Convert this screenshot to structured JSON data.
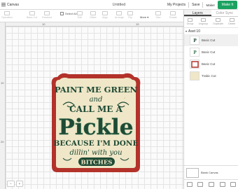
{
  "topbar": {
    "canvas_label": "Canvas",
    "title": "Untitled",
    "my_projects": "My Projects",
    "save": "Save",
    "machine_label": "Maker",
    "machine_sub": "",
    "make_button": "Make It"
  },
  "toolbar": {
    "tools": [
      "Operation",
      "Basic Cut",
      "Deselect",
      "Edit",
      "Offset",
      "Align",
      "Arrange",
      "Flip",
      "Size",
      "Rotate",
      "Position"
    ],
    "select_all": "Select All",
    "more": "More"
  },
  "rulers": {
    "top": [
      "10",
      "15"
    ],
    "left": [
      "10",
      "15",
      "20"
    ]
  },
  "design": {
    "lines": [
      "PAINT ME GREEN",
      "and",
      "CALL ME A",
      "Pickle",
      "BECAUSE I'M DONE",
      "dillin' with you",
      "BITCHES"
    ],
    "colors": {
      "frame_red": "#b3322a",
      "cream": "#efe7c8",
      "dark_green": "#1f4a35",
      "accent_green": "#3f7a57"
    }
  },
  "panel": {
    "tabs": [
      "Layers",
      "Color Sync"
    ],
    "layer_tools": [
      "Group",
      "Ungroup",
      "Duplicate",
      "Delete"
    ],
    "set_name": "Aset 10",
    "layers": [
      {
        "label": "Basic Cut",
        "thumb": "pickle-text-thumb"
      },
      {
        "label": "Basic Cut",
        "thumb": "pickle-text-thumb"
      },
      {
        "label": "Basic Cut",
        "thumb": "frame-thumb"
      },
      {
        "label": "Trabic Cut",
        "thumb": "cream-fill-thumb"
      }
    ],
    "blank_canvas": "Blank Canvas"
  },
  "zoom": {
    "minus": "−",
    "plus": "+"
  }
}
